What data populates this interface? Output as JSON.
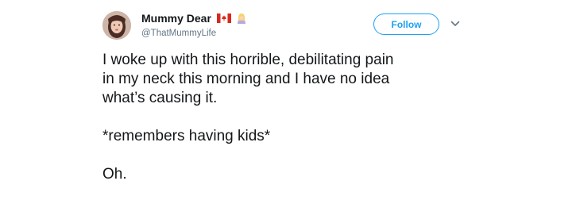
{
  "tweet": {
    "author": {
      "display_name": "Mummy Dear",
      "handle": "@ThatMummyLife",
      "avatar_icon": "avatar-photo",
      "name_badges": [
        "canada-flag-icon",
        "woman-mage-emoji-icon"
      ]
    },
    "follow_label": "Follow",
    "menu_icon": "chevron-down-icon",
    "text_lines": [
      "I woke up with this horrible, debilitating pain",
      "in my neck this morning and I have no idea",
      "what’s causing it.",
      "*remembers having kids*",
      "Oh."
    ]
  },
  "colors": {
    "accent": "#1da1f2",
    "text": "#14171a",
    "secondary_text": "#657786",
    "flag_red": "#d52b1e"
  }
}
